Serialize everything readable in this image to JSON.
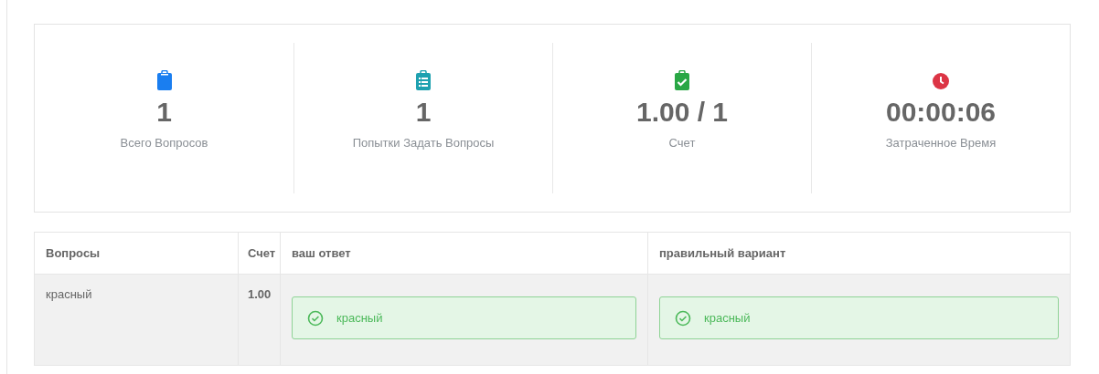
{
  "stats": [
    {
      "kind": "clipboard",
      "value": "1",
      "label": "Всего Вопросов"
    },
    {
      "kind": "list",
      "value": "1",
      "label": "Попытки Задать Вопросы"
    },
    {
      "kind": "check",
      "value": "1.00 / 1",
      "label": "Счет"
    },
    {
      "kind": "clock",
      "value": "00:00:06",
      "label": "Затраченное Время"
    }
  ],
  "table": {
    "columns": [
      "Вопросы",
      "Счет",
      "ваш ответ",
      "правильный вариант"
    ],
    "rows": [
      {
        "question": "красный",
        "score": "1.00",
        "your_answer": {
          "text": "красный",
          "correct": true
        },
        "correct_answer": {
          "text": "красный",
          "correct": true
        }
      }
    ]
  }
}
